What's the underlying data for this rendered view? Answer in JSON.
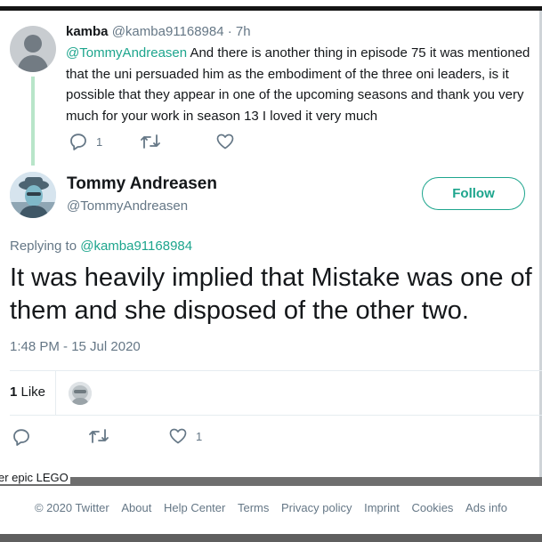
{
  "reply": {
    "author_name": "kamba",
    "author_handle": "@kamba91168984",
    "separator": "·",
    "time_ago": "7h",
    "mention": "@TommyAndreasen",
    "text": " And there is another thing in episode 75 it was mentioned that the uni persuaded him as the embodiment of the three oni leaders, is it possible that they appear in one of the upcoming seasons and thank you very much for your work in season 13 I loved it very much",
    "reply_count": "1",
    "actions": [
      "reply-icon",
      "retweet-icon",
      "like-icon"
    ]
  },
  "tweet": {
    "author_name": "Tommy Andreasen",
    "author_handle": "@TommyAndreasen",
    "follow_label": "Follow",
    "replying_prefix": "Replying to ",
    "replying_to": "@kamba91168984",
    "text": "It was heavily implied that Mistake was one of them and she disposed of the other two.",
    "timestamp": "1:48 PM - 15 Jul 2020",
    "like_count": "1",
    "like_label": " Like",
    "footer_like_count": "1"
  },
  "cut_text": "er epic LEGO",
  "footer": {
    "links": [
      "© 2020 Twitter",
      "About",
      "Help Center",
      "Terms",
      "Privacy policy",
      "Imprint",
      "Cookies",
      "Ads info"
    ]
  },
  "colors": {
    "accent": "#1da58d",
    "muted": "#657786",
    "text": "#14171a",
    "thread_line": "#b8e5c9"
  }
}
